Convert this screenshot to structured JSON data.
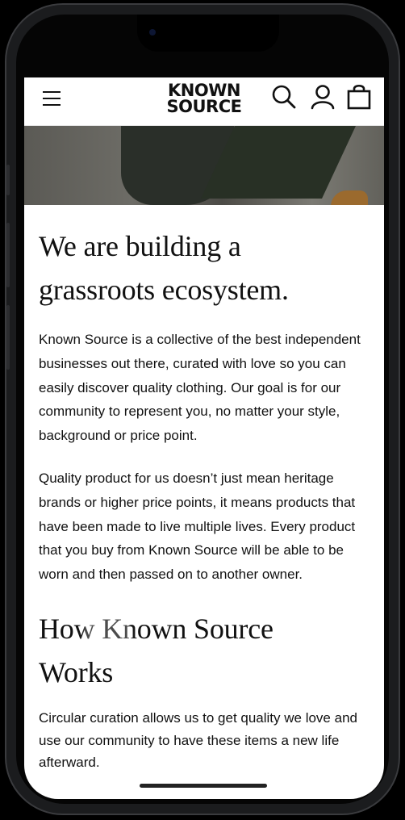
{
  "header": {
    "brand_line1": "KNOWN",
    "brand_line2": "SOURCE",
    "icons": [
      "menu-icon",
      "search-icon",
      "account-icon",
      "bag-icon"
    ]
  },
  "article": {
    "heading1_line1": "We are building a",
    "heading1_line2": "grassroots ecosystem.",
    "para1": [
      "Known Source is a collective of the best independent",
      "businesses out there, curated with love so you can",
      "easily discover quality clothing. Our goal is for our",
      "community to represent you, no matter your style,",
      "background or price point."
    ],
    "para2": [
      "Quality product for us doesn’t just mean heritage",
      "brands or higher price points, it means products that",
      "have been made to live multiple lives. Every product",
      "that you buy from Known Source will be able to be",
      "worn and then passed on to another owner."
    ],
    "heading2_line1": "How Known Source",
    "heading2_line2": "Works",
    "para3": [
      "Circular curation allows us to get quality we love and",
      "use our community to have these items a new life",
      "afterward."
    ]
  }
}
